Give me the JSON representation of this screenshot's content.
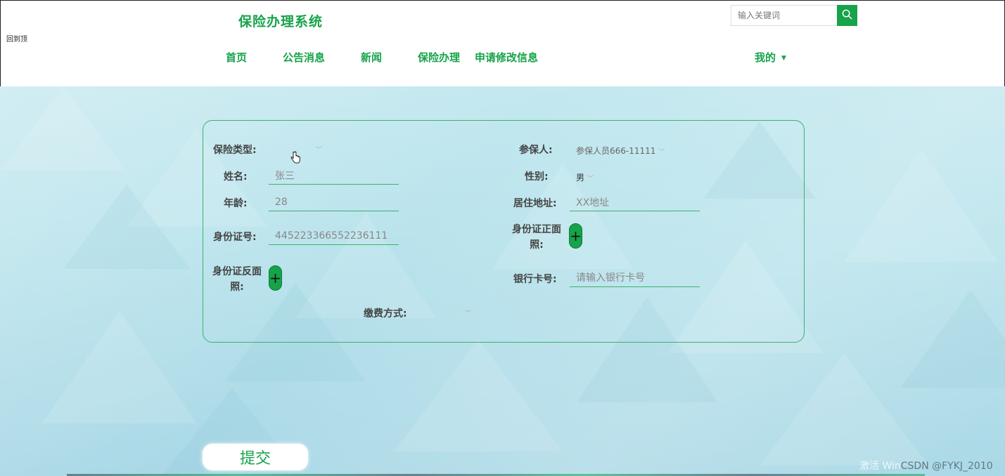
{
  "header": {
    "brand": "保险办理系统",
    "corner_text": "回到顶",
    "search": {
      "placeholder": "输入关键词",
      "icon": "search-icon"
    },
    "nav": [
      {
        "label": "首页"
      },
      {
        "label": "公告消息"
      },
      {
        "label": "新闻"
      },
      {
        "label": "保险办理"
      },
      {
        "label": "申请修改信息"
      }
    ],
    "user_menu": {
      "label": "我的",
      "icon": "caret-down-icon"
    }
  },
  "form": {
    "insurance_type": {
      "label": "保险类型:",
      "value": ""
    },
    "insured_person": {
      "label": "参保人:",
      "value": "参保人员666-11111"
    },
    "name": {
      "label": "姓名:",
      "value": "张三"
    },
    "gender": {
      "label": "性别:",
      "value": "男"
    },
    "age": {
      "label": "年龄:",
      "value": "28"
    },
    "address": {
      "label": "居住地址:",
      "value": "XX地址"
    },
    "id_number": {
      "label": "身份证号:",
      "value": "445223366552236111"
    },
    "id_front": {
      "label": "身份证正面照:",
      "button": "+"
    },
    "id_back": {
      "label": "身份证反面照:",
      "button": "+"
    },
    "bank_card": {
      "label": "银行卡号:",
      "placeholder": "请输入银行卡号"
    },
    "payment": {
      "label": "缴费方式:",
      "value": ""
    }
  },
  "submit": {
    "label": "提交"
  },
  "watermark": {
    "activate": "激活 Win",
    "csdn": "CSDN @FYKJ_2010"
  },
  "colors": {
    "accent": "#16a34a",
    "border": "#3bb26b",
    "background": "#b9e3ec"
  }
}
